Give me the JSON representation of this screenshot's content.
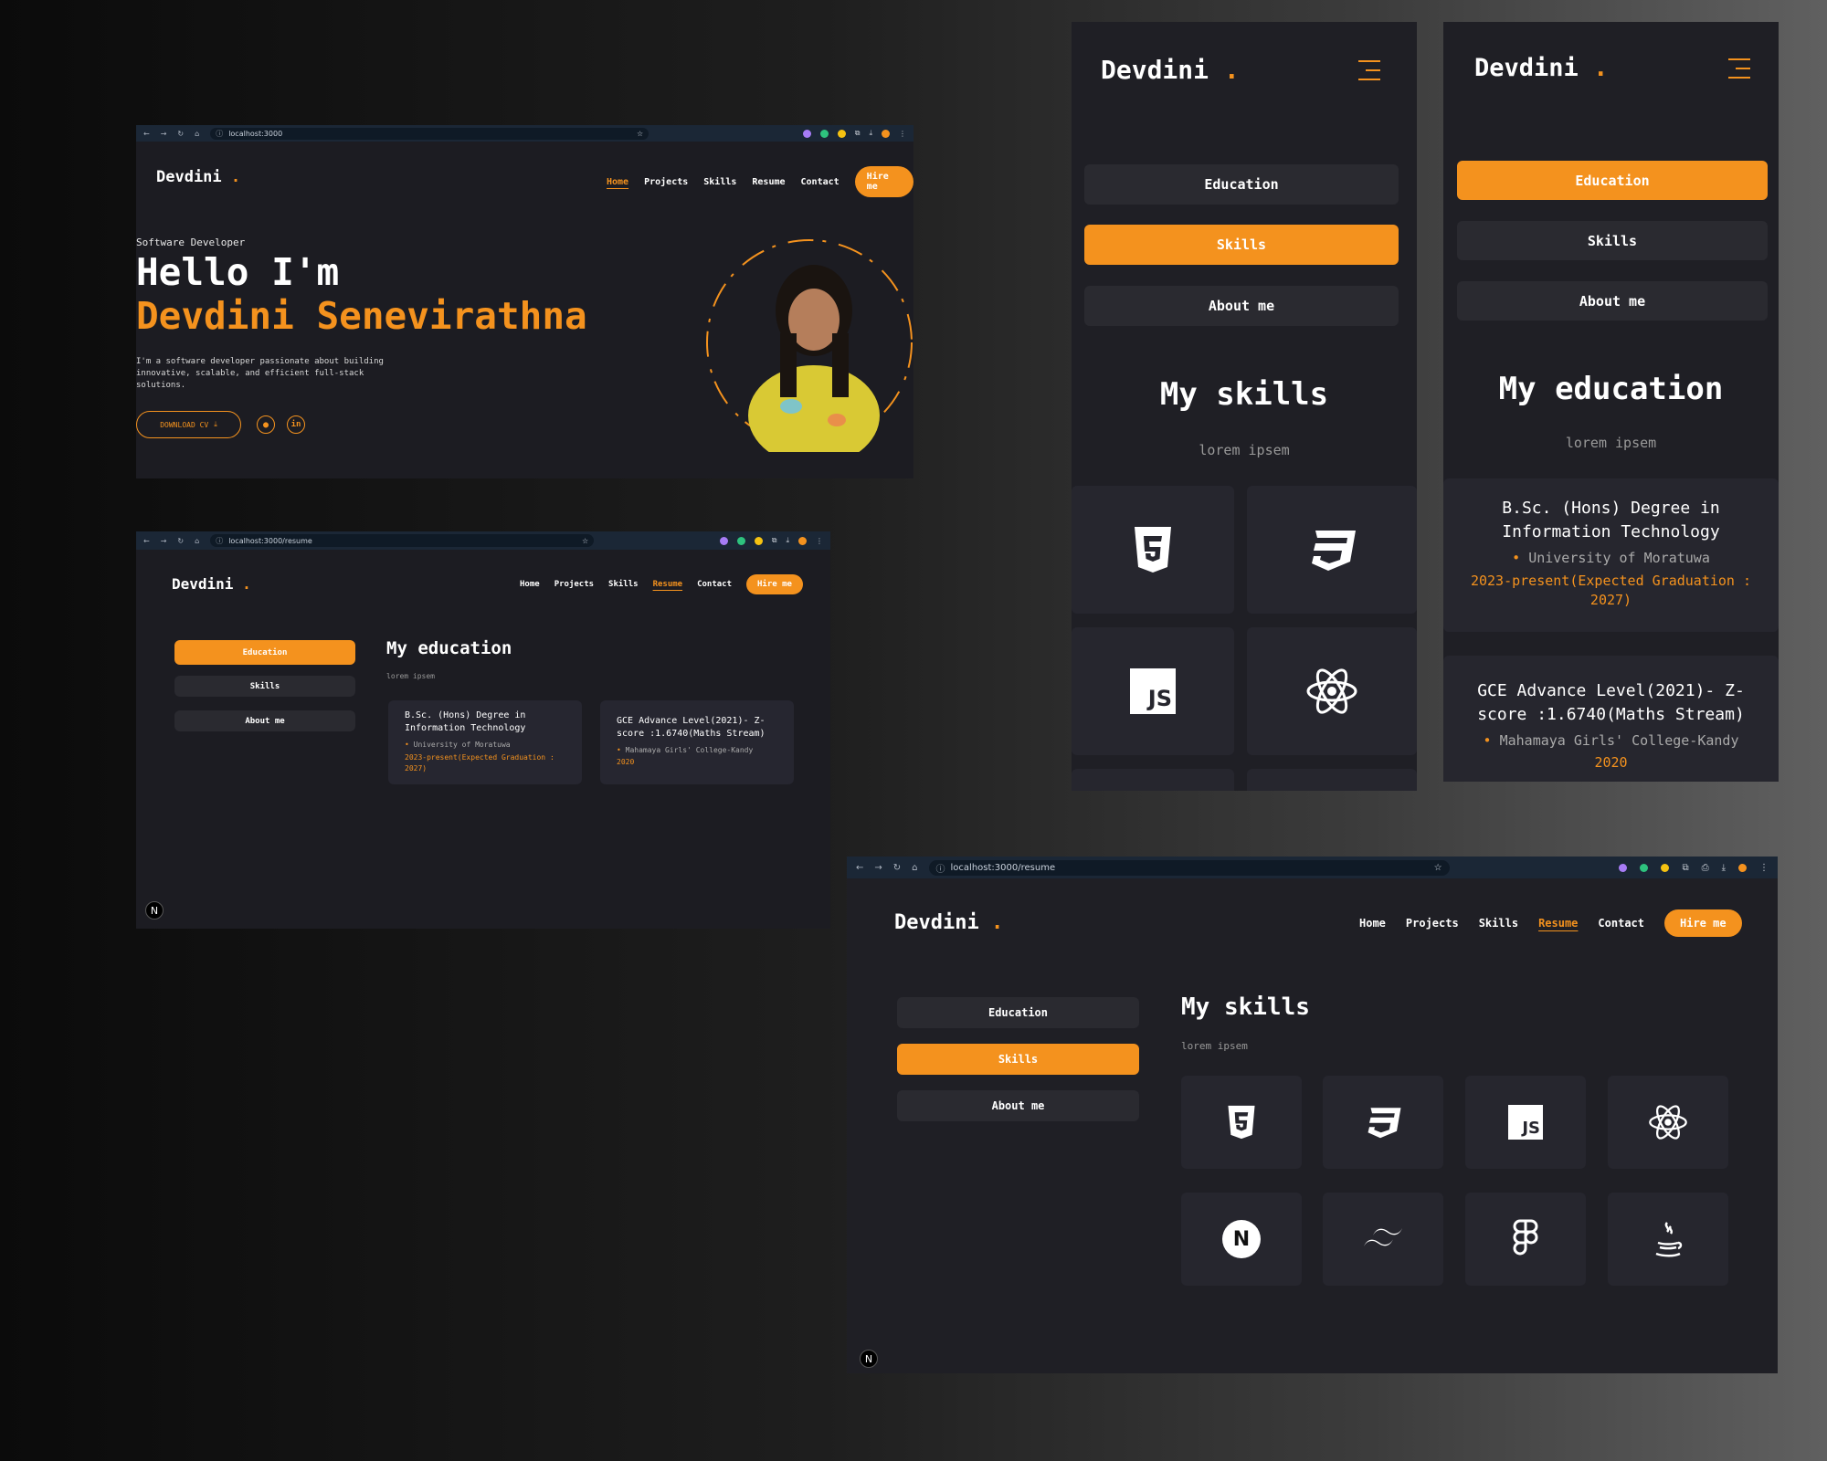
{
  "brand": {
    "name": "Devdini",
    "dot": ".",
    "accent_color": "#f4921e"
  },
  "nav": {
    "home": "Home",
    "projects": "Projects",
    "skills": "Skills",
    "resume": "Resume",
    "contact": "Contact",
    "hire": "Hire me"
  },
  "browser": {
    "url_home": "localhost:3000",
    "url_resume": "localhost:3000/resume"
  },
  "hero": {
    "role": "Software Developer",
    "greeting": "Hello I'm",
    "name": "Devdini Senevirathna",
    "bio_line1": "I'm a software developer passionate about building",
    "bio_line2": "innovative, scalable, and efficient full-stack",
    "bio_line3": "solutions.",
    "download": "DOWNLOAD CV",
    "github_icon": "github-icon",
    "linkedin_icon": "in"
  },
  "resume_tabs": {
    "education": "Education",
    "skills": "Skills",
    "about": "About me"
  },
  "education": {
    "title": "My education",
    "subtitle": "lorem ipsem",
    "items": [
      {
        "degree": "B.Sc. (Hons) Degree in Information Technology",
        "school": "University of Moratuwa",
        "period": "2023-present(Expected Graduation : 2027)"
      },
      {
        "degree": "GCE Advance Level(2021)- Z-score :1.6740(Maths Stream)",
        "school": "Mahamaya Girls' College-Kandy",
        "period": "2020"
      }
    ]
  },
  "skills": {
    "title": "My skills",
    "subtitle": "lorem ipsem",
    "icons": [
      "html5-icon",
      "css3-icon",
      "javascript-icon",
      "react-icon",
      "nextjs-icon",
      "tailwind-icon",
      "figma-icon",
      "java-icon"
    ],
    "js_label": "JS",
    "next_label": "N"
  },
  "next_badge": "N"
}
